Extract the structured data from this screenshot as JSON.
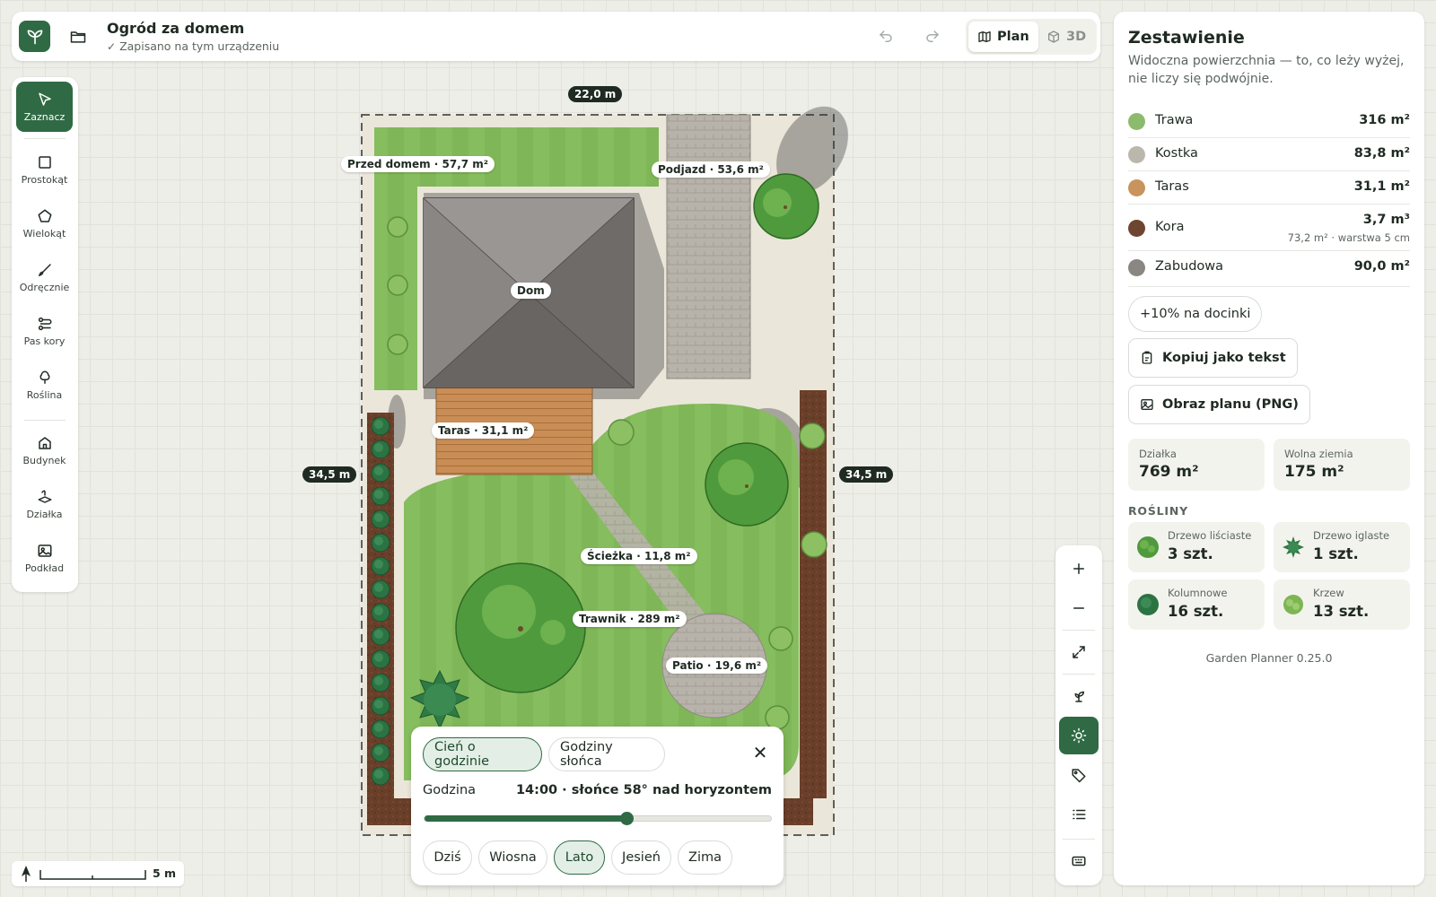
{
  "header": {
    "title": "Ogród za domem",
    "save_status": "Zapisano na tym urządzeniu",
    "view_plan": "Plan",
    "view_3d": "3D"
  },
  "toolbar": {
    "tools": [
      {
        "label": "Zaznacz",
        "icon": "cursor-icon",
        "active": true
      },
      {
        "label": "Prostokąt",
        "icon": "square-icon"
      },
      {
        "label": "Wielokąt",
        "icon": "pentagon-icon"
      },
      {
        "label": "Odręcznie",
        "icon": "brush-icon"
      },
      {
        "label": "Pas kory",
        "icon": "path-icon"
      },
      {
        "label": "Roślina",
        "icon": "tree-icon"
      },
      {
        "label": "Budynek",
        "icon": "house-icon"
      },
      {
        "label": "Działka",
        "icon": "plot-icon"
      },
      {
        "label": "Podkład",
        "icon": "image-icon"
      }
    ]
  },
  "plan": {
    "dimension_top": "22,0 m",
    "dimension_left": "34,5 m",
    "dimension_right": "34,5 m",
    "labels": {
      "front": "Przed domem · 57,7 m²",
      "driveway": "Podjazd · 53,6 m²",
      "house": "Dom",
      "terrace": "Taras · 31,1 m²",
      "path": "Ścieżka · 11,8 m²",
      "lawn": "Trawnik · 289 m²",
      "patio": "Patio · 19,6 m²"
    }
  },
  "shadow_panel": {
    "mode_shadow": "Cień o godzinie",
    "mode_sun_hours": "Godziny słońca",
    "hour_label": "Godzina",
    "hour_value": "14:00 · słońce 58° nad horyzontem",
    "slider_fraction": 0.58,
    "presets": [
      "Dziś",
      "Wiosna",
      "Lato",
      "Jesień",
      "Zima"
    ],
    "active_preset": "Lato"
  },
  "scale": {
    "label": "5 m"
  },
  "summary": {
    "title": "Zestawienie",
    "subtitle": "Widoczna powierzchnia — to, co leży wyżej, nie liczy się podwójnie.",
    "materials": [
      {
        "name": "Trawa",
        "value": "316 m²",
        "color": "#8dbb6e"
      },
      {
        "name": "Kostka",
        "value": "83,8 m²",
        "color": "#bcb7ad"
      },
      {
        "name": "Taras",
        "value": "31,1 m²",
        "color": "#c8935c"
      },
      {
        "name": "Kora",
        "value": "3,7 m³",
        "note": "73,2 m² · warstwa 5 cm",
        "color": "#6e4530"
      },
      {
        "name": "Zabudowa",
        "value": "90,0 m²",
        "color": "#8a8782"
      }
    ],
    "waste_button": "+10% na docinki",
    "copy_button": "Kopiuj jako tekst",
    "png_button": "Obraz planu (PNG)",
    "stats": [
      {
        "label": "Działka",
        "value": "769 m²"
      },
      {
        "label": "Wolna ziemia",
        "value": "175 m²"
      }
    ],
    "plants_heading": "ROŚLINY",
    "plants": [
      {
        "label": "Drzewo liściaste",
        "value": "3 szt."
      },
      {
        "label": "Drzewo iglaste",
        "value": "1 szt."
      },
      {
        "label": "Kolumnowe",
        "value": "16 szt."
      },
      {
        "label": "Krzew",
        "value": "13 szt."
      }
    ],
    "version": "Garden Planner 0.25.0"
  },
  "colors": {
    "accent": "#2f6a44",
    "grass": "#8dbb6e",
    "paving": "#bcb7ad",
    "deck": "#c8935c",
    "bark": "#6e4530",
    "building": "#8a8782"
  }
}
